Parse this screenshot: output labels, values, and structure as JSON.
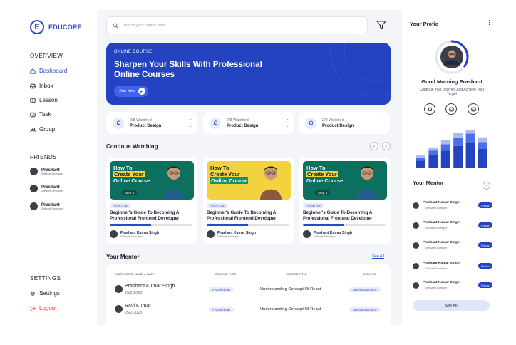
{
  "brand": {
    "logo_letter": "E",
    "name": "EDUCORE",
    "accent": "#2443c0",
    "danger": "#e0372c"
  },
  "sidebar": {
    "overview_label": "OVERVIEW",
    "items": [
      {
        "label": "Dashboard",
        "icon": "home-icon",
        "active": true
      },
      {
        "label": "Inbox",
        "icon": "inbox-icon"
      },
      {
        "label": "Lesson",
        "icon": "book-icon"
      },
      {
        "label": "Task",
        "icon": "task-icon"
      },
      {
        "label": "Group",
        "icon": "group-icon"
      }
    ],
    "friends_label": "FRIENDS",
    "friends": [
      {
        "name": "Prashant",
        "role": "Software Developer"
      },
      {
        "name": "Prashant",
        "role": "Software Developer"
      },
      {
        "name": "Prashant",
        "role": "Software Developer"
      }
    ],
    "settings_label": "SETTINGS",
    "settings_item": "Settings",
    "logout_item": "Logout"
  },
  "search": {
    "placeholder": "Search your course here...."
  },
  "banner": {
    "eyebrow": "ONLINE COURSE",
    "title": "Sharpen  Your Skills With Professional Online Courses",
    "button": "Join Now",
    "button_icon": "▸"
  },
  "stats": [
    {
      "watched": "2/8 Watched",
      "title": "Product Design",
      "icon": "bell-icon"
    },
    {
      "watched": "2/8 Watched",
      "title": "Product Design",
      "icon": "bell-icon"
    },
    {
      "watched": "2/8 Watched",
      "title": "Product Design",
      "icon": "bell-icon"
    }
  ],
  "continue": {
    "heading": "Continue Watching",
    "prev": "‹",
    "next": "›",
    "courses": [
      {
        "thumb_line1": "How To",
        "thumb_line2": "Create Your",
        "thumb_line3": "Online Course",
        "step": "Step 3",
        "badge": "FRONTEND",
        "title": "Beginner's Guide To Becoming A Professional Frontend Developer",
        "progress": 0.5,
        "author": "Prashant Kumar Singh",
        "role": "Software Developer"
      },
      {
        "thumb_line1": "How To",
        "thumb_line2": "Create Your",
        "thumb_line3": "Online Course",
        "step": "",
        "badge": "FRONTEND",
        "title": "Beginner's Guide To Becoming A Professional Frontend Developer",
        "progress": 0.5,
        "author": "Prashant Kumar Singh",
        "role": "Software Developer"
      },
      {
        "thumb_line1": "How To",
        "thumb_line2": "Create Your",
        "thumb_line3": "Online Course",
        "step": "Step 3",
        "badge": "FRONTEND",
        "title": "Beginner's Guide To Becoming A Professional Frontend Developer",
        "progress": 0.5,
        "author": "Prashant Kumar Singh",
        "role": "Software Developer"
      }
    ]
  },
  "mentor_table": {
    "heading": "Your Mentor",
    "see_all": "See All",
    "columns": [
      "INSTRUCTOR NAME & DATE",
      "COURSE TYPE",
      "COURSE TITLE",
      "ACTIONS"
    ],
    "rows": [
      {
        "name": "Prashant Kumar Singh",
        "date": "25/2/2023",
        "type": "FRONTEND",
        "course": "Understanding Concept Of React",
        "action": "SHOW DETAILS"
      },
      {
        "name": "Ravi Kumar",
        "date": "25/2/2023",
        "type": "FRONTEND",
        "course": "Understanding Concept Of React",
        "action": "SHOW DETAILS"
      }
    ]
  },
  "profile": {
    "title": "Your Profie",
    "greeting": "Good Morning Prashant",
    "subtitle": "Continue Your Journey And Achieve Your Target",
    "progress": 0.35,
    "actions": [
      "bell-icon",
      "inbox-icon",
      "inbox-icon"
    ],
    "chart_bars": [
      {
        "segments": [
          0.2,
          0.08,
          0.06
        ]
      },
      {
        "segments": [
          0.34,
          0.12,
          0.08
        ]
      },
      {
        "segments": [
          0.46,
          0.16,
          0.12
        ]
      },
      {
        "segments": [
          0.58,
          0.2,
          0.14
        ]
      },
      {
        "segments": [
          0.66,
          0.24,
          0.16
        ]
      },
      {
        "segments": [
          0.5,
          0.18,
          0.12
        ]
      }
    ],
    "chart_colors": [
      "#2443c0",
      "#4c6ee8",
      "#a9bdf4"
    ]
  },
  "mentors": {
    "heading": "Your Mentor",
    "next": "›",
    "follow_label": "Follow",
    "list": [
      {
        "name": "Prashant Kumar Singh",
        "role": "Software Developer"
      },
      {
        "name": "Prashant Kumar Singh",
        "role": "Software Developer"
      },
      {
        "name": "Prashant Kumar Singh",
        "role": "Software Developer"
      },
      {
        "name": "Prashant Kumar Singh",
        "role": "Software Developer"
      },
      {
        "name": "Prashant Kumar Singh",
        "role": "Software Developer"
      }
    ],
    "see_all": "See All"
  }
}
